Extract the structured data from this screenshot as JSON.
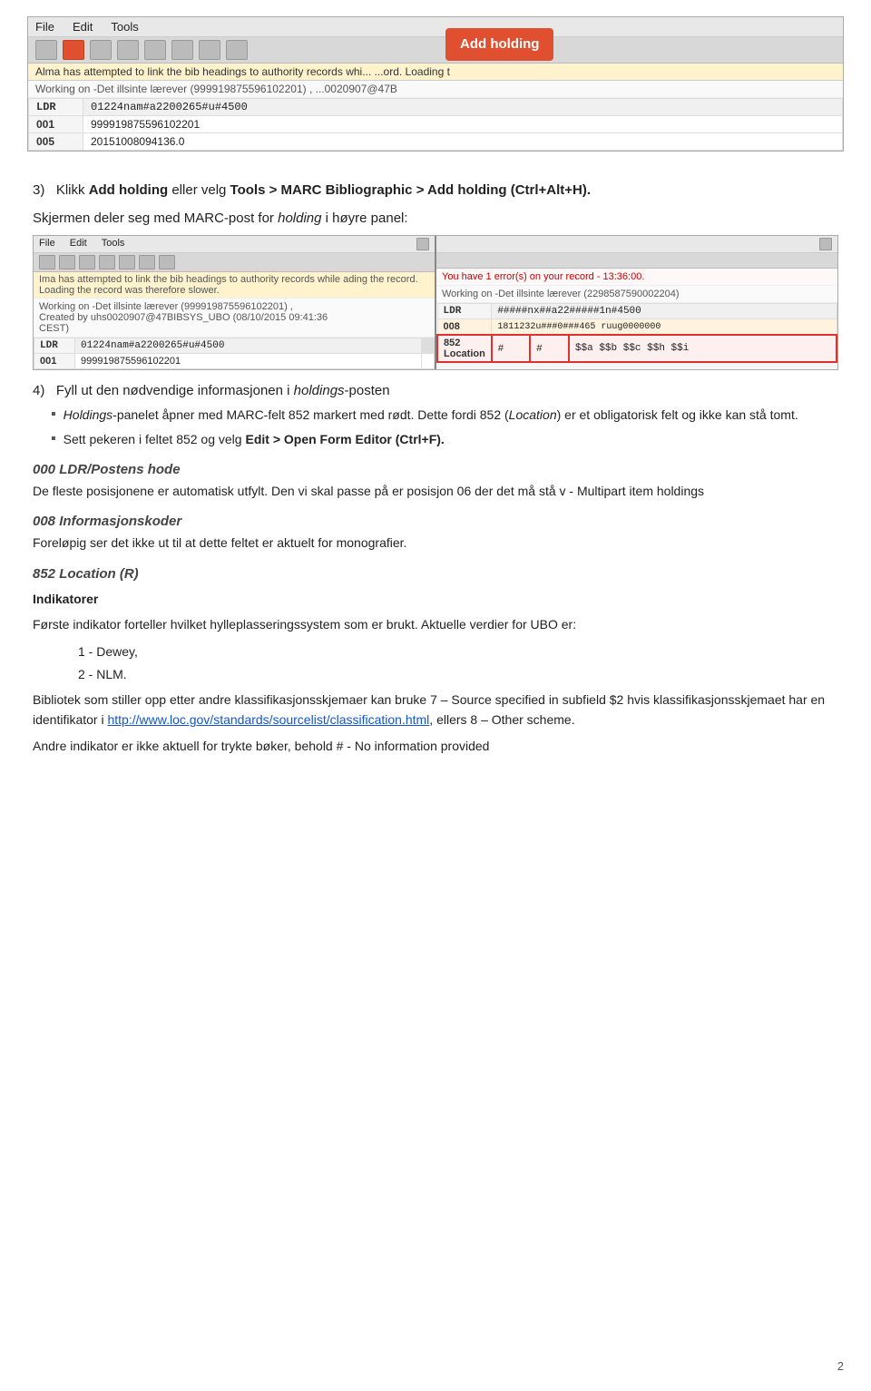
{
  "top_screenshot": {
    "menubar": [
      "File",
      "Edit",
      "Tools"
    ],
    "info_bar": "Alma has attempted to link the bib headings to authority records whi... ...ord. Loading t",
    "working_bar": "Working on -Det illsinte lærever (999919875596102201) ,    ...0020907@47B",
    "marc_rows": [
      {
        "tag": "LDR",
        "value": "01224nam#a2200265#u#4500"
      },
      {
        "tag": "001",
        "value": "999919875596102201"
      },
      {
        "tag": "005",
        "value": "20151008094136.0"
      }
    ]
  },
  "step3": {
    "text": "3)   Klikk ",
    "bold1": "Add holding",
    "text2": " eller velg ",
    "bold2": "Tools > MARC Bibliographic > Add holding (Ctrl+Alt+H)."
  },
  "step3b": {
    "text": "Skjermen deler seg med MARC-post for ",
    "italic": "holding",
    "text2": " i høyre panel:"
  },
  "split_screenshot": {
    "left": {
      "menubar": [
        "File",
        "Edit",
        "Tools"
      ],
      "info_bar": "Ima has attempted to link the bib headings to authority records while ading the record. Loading the record was therefore slower.",
      "working_bar": "Working on -Det illsinte lærever (999919875596102201) ,\nCreated by uhs0020907@47BIBSYS_UBO (08/10/2015 09:41:36\nCEST)",
      "marc_rows": [
        {
          "tag": "LDR",
          "value": "01224nam#a2200265#u#4500",
          "ldr": true
        },
        {
          "tag": "001",
          "value": "999919875596102201"
        }
      ]
    },
    "right": {
      "error_bar": "You have 1 error(s) on your record - 13:36:00.",
      "working_bar": "Working on -Det illsinte lærever (2298587590002204)",
      "marc_rows": [
        {
          "tag": "LDR",
          "value": "#####nx##a22#####1n#4500",
          "ldr": true
        },
        {
          "tag": "008",
          "value": "1811232u###0###465 ruug0000000",
          "highlighted": true
        },
        {
          "tag": "852",
          "ind1": "#",
          "ind2": "#",
          "value": "$$a $$b $$c $$h $$i",
          "red_border": true
        }
      ]
    }
  },
  "step4": {
    "text": "4)   Fyll ut den nødvendige informasjonen i ",
    "italic": "holdings",
    "text2": "-posten"
  },
  "bullets": [
    {
      "text": "",
      "parts": [
        {
          "type": "italic",
          "text": "Holdings"
        },
        {
          "type": "normal",
          "text": "-panelet åpner med MARC-felt 852 markert med rødt. Dette fordi 852 ("
        },
        {
          "type": "italic",
          "text": "Location"
        },
        {
          "type": "normal",
          "text": ") er et obligatorisk felt og ikke kan stå tomt."
        }
      ]
    },
    {
      "parts": [
        {
          "type": "normal",
          "text": "Sett pekeren i feltet 852 og velg "
        },
        {
          "type": "bold",
          "text": "Edit > Open Form Editor (Ctrl+F)."
        }
      ]
    }
  ],
  "section_000": {
    "heading": "000 LDR/Postens hode",
    "para": "De fleste posisjonene er automatisk utfylt. Den vi skal passe på er posisjon 06 der det må stå v - Multipart item holdings"
  },
  "section_008": {
    "heading": "008 Informasjonskoder",
    "para": "Foreløpig ser det ikke ut til at dette feltet er aktuelt for monografier."
  },
  "section_852": {
    "heading": "852 Location (R)",
    "indikatorer_heading": "Indikatorer",
    "para1": "Første indikator forteller hvilket hylleplasseringssystem som er brukt. Aktuelle verdier for UBO er:",
    "list_items": [
      "1 - Dewey,",
      "2 - NLM."
    ],
    "para2": "Bibliotek som stiller opp etter andre klassifikasjonsskjemaer kan bruke 7 – Source specified in subfield $2 hvis klassifikasjonsskjemaet har en identifikator i ",
    "link_text": "http://www.loc.gov/standards/sourcelist/classification.html",
    "link_url": "http://www.loc.gov/standards/sourcelist/classification.html",
    "para2_end": ", ellers 8 – Other scheme.",
    "para3": "Andre indikator er ikke aktuell for trykte bøker, behold # - No information provided"
  },
  "page_number": "2",
  "add_holding_popup": "Add\nholding"
}
